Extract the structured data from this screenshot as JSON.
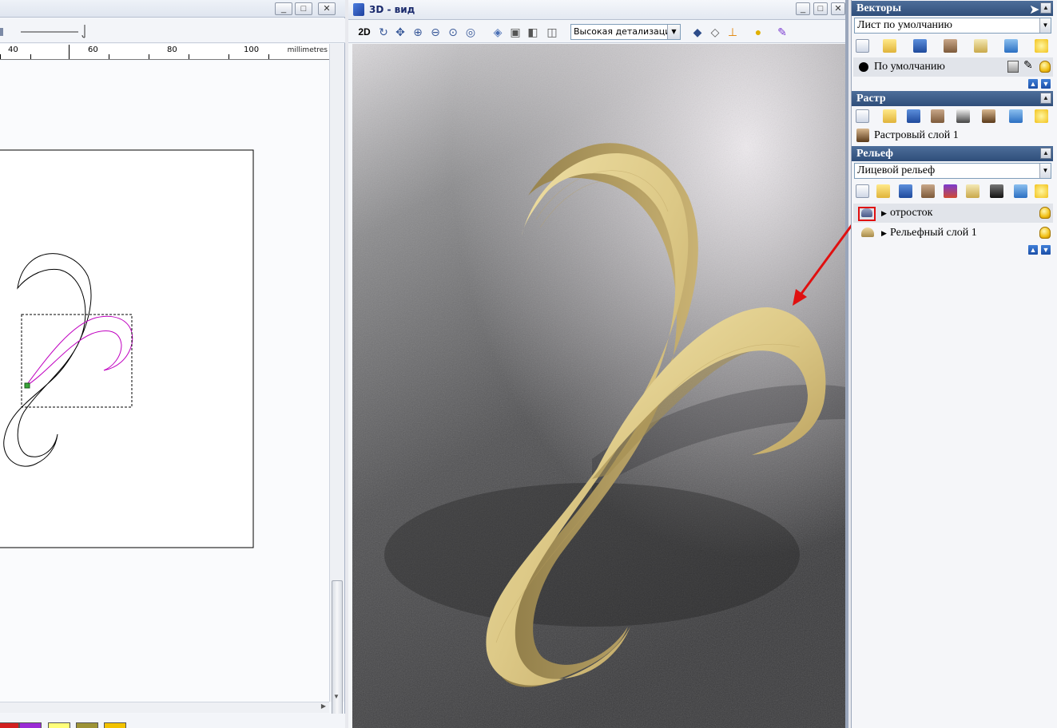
{
  "window_2d": {
    "ruler_labels": [
      "40",
      "60",
      "80",
      "100"
    ],
    "ruler_unit": "millimetres",
    "palette_colors": [
      "#d21f1f",
      "#9b2bd6",
      "#ffff7a",
      "#9d9336",
      "#f2c200"
    ]
  },
  "window_3d": {
    "title": "3D - вид",
    "btn_2d": "2D",
    "detail_select": "Высокая детализация"
  },
  "panel": {
    "vectors": {
      "header": "Векторы",
      "sheet_select": "Лист по умолчанию",
      "layer_label": "По умолчанию"
    },
    "raster": {
      "header": "Растр",
      "layer_label": "Растровый слой 1"
    },
    "relief": {
      "header": "Рельеф",
      "relief_select": "Лицевой рельеф",
      "layers": [
        {
          "label": "отросток"
        },
        {
          "label": "Рельефный слой 1"
        }
      ]
    }
  },
  "colors": {
    "panel_header": "#3b5b88",
    "highlight_red": "#e01010",
    "relief_wood": "#e6d49a"
  }
}
